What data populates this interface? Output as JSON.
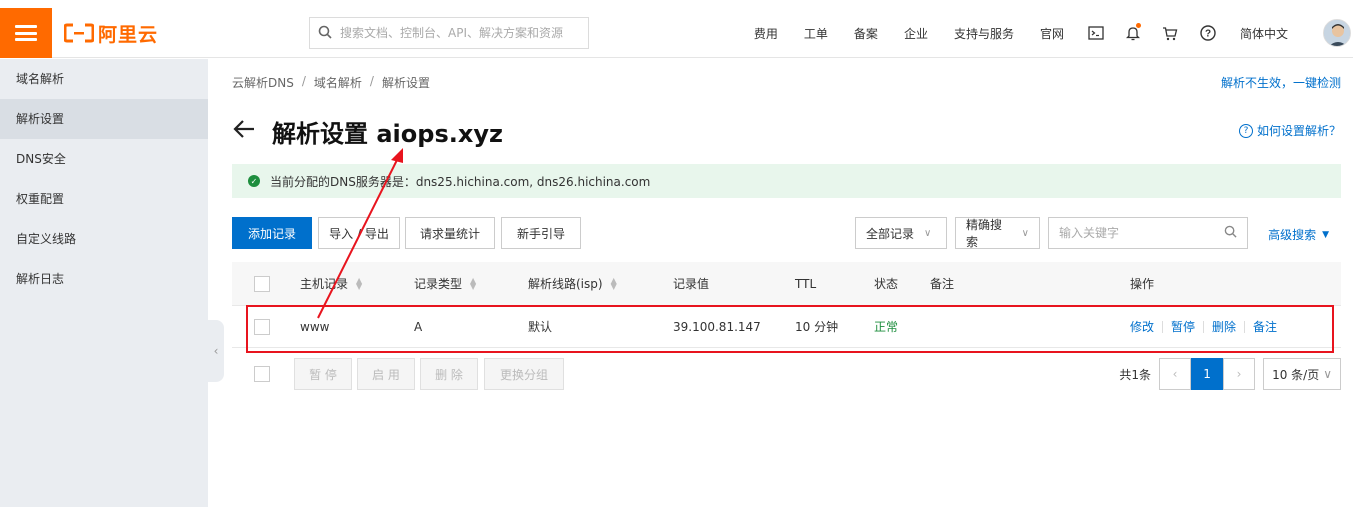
{
  "header": {
    "logo_text": "阿里云",
    "search_placeholder": "搜索文档、控制台、API、解决方案和资源",
    "nav": [
      "费用",
      "工单",
      "备案",
      "企业",
      "支持与服务",
      "官网"
    ],
    "language": "简体中文",
    "brand_color": "#ff6a00"
  },
  "sidebar": {
    "items": [
      {
        "label": "域名解析"
      },
      {
        "label": "解析设置"
      },
      {
        "label": "DNS安全"
      },
      {
        "label": "权重配置"
      },
      {
        "label": "自定义线路"
      },
      {
        "label": "解析日志"
      }
    ],
    "active_index": 1
  },
  "breadcrumb": [
    "云解析DNS",
    "域名解析",
    "解析设置"
  ],
  "top_link": "解析不生效，一键检测",
  "page_title": "解析设置 aiops.xyz",
  "help_link": "如何设置解析？",
  "notice": "当前分配的DNS服务器是：dns25.hichina.com, dns26.hichina.com",
  "toolbar": {
    "add": "添加记录",
    "import_export": "导入 / 导出",
    "stats": "请求量统计",
    "guide": "新手引导",
    "filter_select": "全部记录",
    "search_mode": "精确搜索",
    "keyword_placeholder": "输入关键字",
    "advanced": "高级搜索"
  },
  "table": {
    "headers": [
      "主机记录",
      "记录类型",
      "解析线路(isp)",
      "记录值",
      "TTL",
      "状态",
      "备注",
      "操作"
    ],
    "rows": [
      {
        "host": "www",
        "type": "A",
        "line": "默认",
        "value": "39.100.81.147",
        "ttl": "10 分钟",
        "status": "正常",
        "note": "",
        "actions": [
          "修改",
          "暂停",
          "删除",
          "备注"
        ]
      }
    ]
  },
  "footer": {
    "buttons": [
      "暂 停",
      "启 用",
      "删 除",
      "更换分组"
    ],
    "total": "共1条",
    "page": "1",
    "page_size": "10 条/页"
  },
  "colors": {
    "accent": "#0070cc",
    "ok": "#1e8e3e",
    "annotation": "#e8141e"
  }
}
